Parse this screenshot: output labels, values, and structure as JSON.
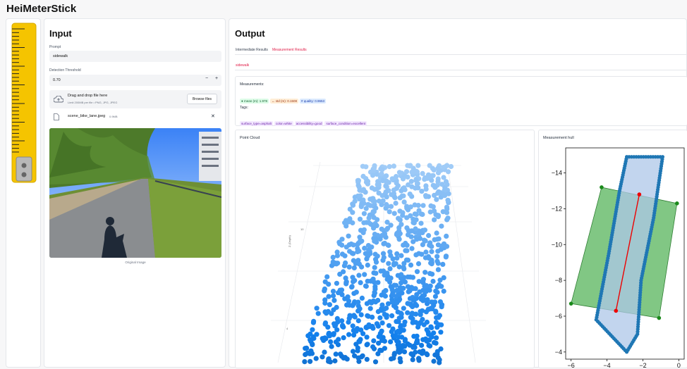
{
  "app": {
    "title": "HeiMeterStick"
  },
  "input": {
    "heading": "Input",
    "prompt_label": "Prompt",
    "prompt_value": "sidewalk",
    "threshold_label": "Detection Threshold",
    "threshold_value": "0.70",
    "dec_symbol": "−",
    "inc_symbol": "+",
    "upload": {
      "title": "Drag and drop file here",
      "subtitle": "Limit 200MB per file • PNG, JPG, JPEG",
      "browse_label": "Browse files"
    },
    "file": {
      "name": "scene_bike_lane.jpeg",
      "size": "0.9MB",
      "remove_symbol": "✕"
    },
    "image_caption": "Original Image"
  },
  "output": {
    "heading": "Output",
    "tabs": [
      "Intermediate Results",
      "Measurement Results"
    ],
    "active_tab": 1,
    "subtab": "sidewalk",
    "measurements_label": "Measurements:",
    "measurement_pills": [
      {
        "text": "● mean (m): 1.978",
        "bg": "#dcfce7",
        "fg": "#166534"
      },
      {
        "text": "↔ std (m): 0.1508",
        "bg": "#ffedd5",
        "fg": "#9a3412"
      },
      {
        "text": "# quality: 0.9653",
        "bg": "#dbeafe",
        "fg": "#1e40af"
      }
    ],
    "tags_label": "Tags:",
    "tags": [
      "surface_type=asphalt",
      "color=white",
      "accessibility=good",
      "surface_condition=excellent"
    ],
    "point_cloud_title": "Point Cloud",
    "point_cloud_axis_label": "Z (Depth)",
    "point_cloud_tick_a": "10",
    "point_cloud_tick_b": "4",
    "hull_title": "Measurement hull"
  },
  "chart_data": {
    "type": "scatter",
    "title": "Measurement hull",
    "xlabel": "",
    "ylabel": "",
    "xlim": [
      -6.3,
      0.3
    ],
    "ylim": [
      -3.6,
      -15.4
    ],
    "x_ticks": [
      -6,
      -4,
      -2,
      0
    ],
    "y_ticks": [
      -4,
      -6,
      -8,
      -10,
      -12,
      -14
    ],
    "x_tick_labels": [
      "−6",
      "−4",
      "−2",
      "0"
    ],
    "y_tick_labels": [
      "−4",
      "−6",
      "−8",
      "−10",
      "−12",
      "−14"
    ],
    "rectangle": [
      [
        -6.0,
        -6.7
      ],
      [
        -4.3,
        -13.2
      ],
      [
        -0.1,
        -12.3
      ],
      [
        -1.1,
        -5.9
      ]
    ],
    "hull": [
      [
        -2.9,
        -14.9
      ],
      [
        -0.9,
        -14.9
      ],
      [
        -1.4,
        -11.5
      ],
      [
        -2.1,
        -8.0
      ],
      [
        -2.3,
        -5.0
      ],
      [
        -2.9,
        -4.0
      ],
      [
        -4.6,
        -5.8
      ],
      [
        -3.9,
        -9.5
      ],
      [
        -3.3,
        -13.0
      ]
    ],
    "measure_line": [
      [
        -3.5,
        -6.3
      ],
      [
        -2.2,
        -12.8
      ]
    ],
    "colors": {
      "rect_fill": "#4caf50",
      "rect_edge": "#2e7d32",
      "hull_fill": "#aec7e8",
      "hull_edge": "#1f77b4",
      "line": "#ee0000",
      "corner": "#1a8a1a"
    }
  }
}
